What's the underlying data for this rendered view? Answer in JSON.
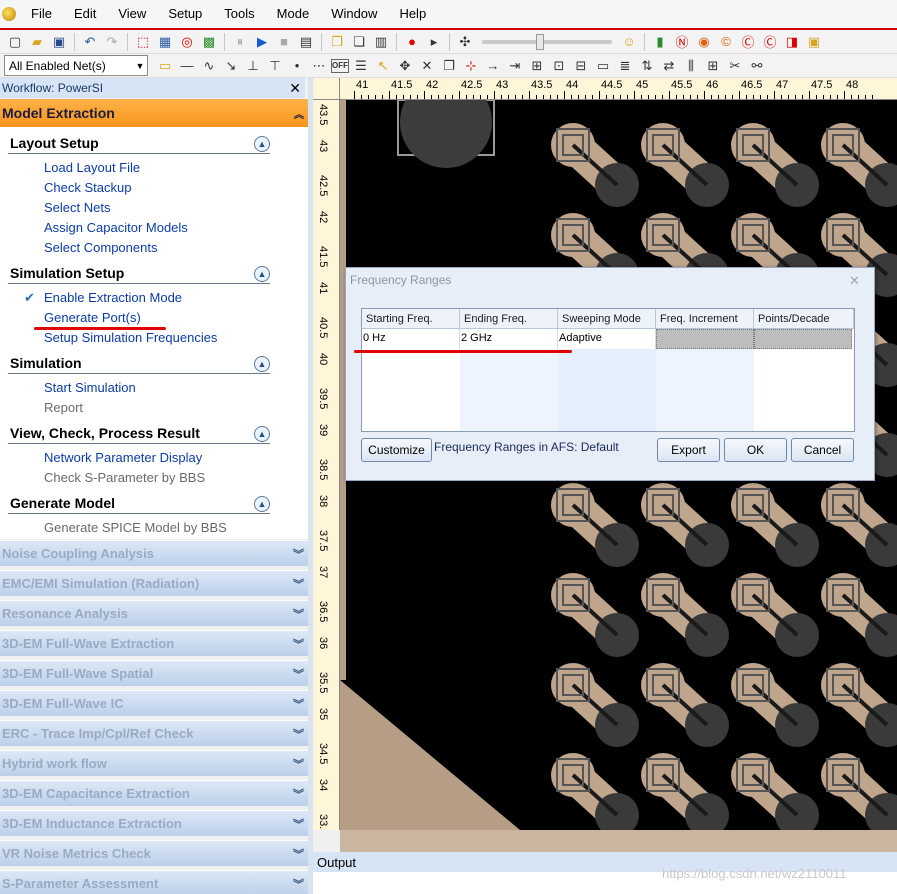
{
  "menu": {
    "items": [
      "File",
      "Edit",
      "View",
      "Setup",
      "Tools",
      "Mode",
      "Window",
      "Help"
    ]
  },
  "toolbar": {
    "net_filter": "All Enabled Net(s)",
    "off_label": "OFF"
  },
  "workflow": {
    "title": "Workflow: PowerSI",
    "active_section": "Model Extraction",
    "groups": [
      {
        "title": "Layout Setup",
        "items": [
          {
            "label": "Load Layout File",
            "enabled": true
          },
          {
            "label": "Check Stackup",
            "enabled": true
          },
          {
            "label": "Select Nets",
            "enabled": true
          },
          {
            "label": "Assign Capacitor Models",
            "enabled": true
          },
          {
            "label": "Select Components",
            "enabled": true
          }
        ]
      },
      {
        "title": "Simulation Setup",
        "items": [
          {
            "label": "Enable Extraction Mode",
            "enabled": true,
            "checked": true
          },
          {
            "label": "Generate Port(s)",
            "enabled": true
          },
          {
            "label": "Setup Simulation Frequencies",
            "enabled": true
          }
        ]
      },
      {
        "title": "Simulation",
        "items": [
          {
            "label": "Start Simulation",
            "enabled": true
          },
          {
            "label": "Report",
            "enabled": false
          }
        ]
      },
      {
        "title": "View, Check, Process Result",
        "items": [
          {
            "label": "Network Parameter Display",
            "enabled": true
          },
          {
            "label": "Check S-Parameter by BBS",
            "enabled": false
          }
        ]
      },
      {
        "title": "Generate Model",
        "items": [
          {
            "label": "Generate SPICE Model by BBS",
            "enabled": false
          }
        ]
      }
    ],
    "collapsed_sections": [
      "Noise Coupling Analysis",
      "EMC/EMI Simulation (Radiation)",
      "Resonance Analysis",
      "3D-EM Full-Wave Extraction",
      "3D-EM Full-Wave Spatial",
      "3D-EM Full-Wave IC",
      "ERC - Trace Imp/Cpl/Ref Check",
      "Hybrid work flow",
      "3D-EM Capacitance Extraction",
      "3D-EM Inductance Extraction",
      "VR Noise Metrics Check",
      "S-Parameter Assessment"
    ]
  },
  "ruler": {
    "x_labels": [
      "41",
      "41.5",
      "42",
      "42.5",
      "43",
      "43.5",
      "44",
      "44.5",
      "45",
      "45.5",
      "46",
      "46.5",
      "47",
      "47.5",
      "48"
    ],
    "y_labels": [
      "43.5",
      "43",
      "42.5",
      "42",
      "41.5",
      "41",
      "40.5",
      "40",
      "39.5",
      "39",
      "38.5",
      "38",
      "37.5",
      "37",
      "36.5",
      "36",
      "35.5",
      "35",
      "34.5",
      "34",
      "33.5"
    ]
  },
  "dialog": {
    "title": "Frequency Ranges",
    "columns": [
      "Starting Freq.",
      "Ending Freq.",
      "Sweeping Mode",
      "Freq. Increment",
      "Points/Decade"
    ],
    "rows": [
      {
        "start": "0 Hz",
        "end": "2 GHz",
        "mode": "Adaptive",
        "increment": "",
        "points": ""
      }
    ],
    "customize_label": "Customize",
    "afs_label": "Frequency Ranges in AFS: Default",
    "export_label": "Export",
    "ok_label": "OK",
    "cancel_label": "Cancel"
  },
  "output": {
    "title": "Output"
  },
  "watermark": "https://blog.csdn.net/wz2110011",
  "colors": {
    "accent_red": "#d40000",
    "section_orange": "#f7941d",
    "link_blue": "#0c3ca8",
    "pad_tan": "#bfa58c"
  }
}
